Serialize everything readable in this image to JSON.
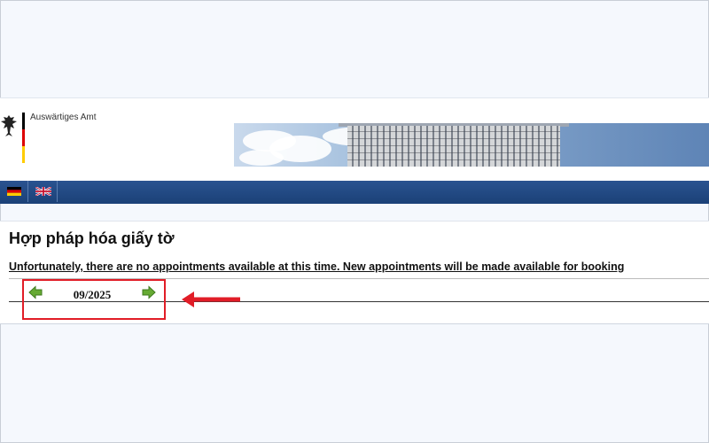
{
  "header": {
    "brand": "Auswärtiges Amt",
    "banner_image": "building-banner",
    "logo_icon": "federal-eagle-icon"
  },
  "nav": {
    "languages": [
      {
        "code": "de",
        "icon": "flag-de-icon"
      },
      {
        "code": "en",
        "icon": "flag-uk-icon"
      }
    ]
  },
  "page": {
    "title": "Hợp pháp hóa giấy tờ",
    "notice": "Unfortunately, there are no appointments available at this time. New appointments will be made available for booking"
  },
  "calendar": {
    "month_label": "09/2025",
    "prev_icon": "arrow-left-icon",
    "next_icon": "arrow-right-icon"
  },
  "annotation": {
    "box_color": "#e11d27",
    "arrow_icon": "red-arrow-left-icon"
  },
  "colors": {
    "nav_blue": "#1c4279",
    "arrow_green": "#66aa33",
    "background": "#f5f8fd"
  }
}
